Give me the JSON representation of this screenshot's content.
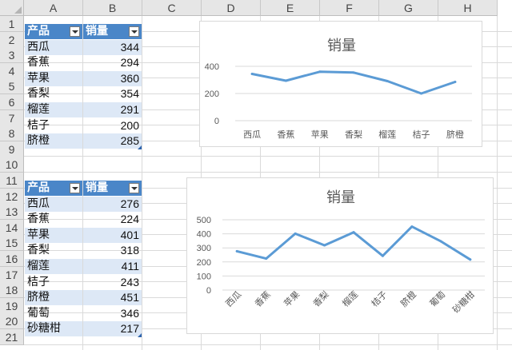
{
  "columns": [
    "A",
    "B",
    "C",
    "D",
    "E",
    "F",
    "G",
    "H"
  ],
  "rows": [
    "1",
    "2",
    "3",
    "4",
    "5",
    "6",
    "7",
    "8",
    "9",
    "10",
    "11",
    "12",
    "13",
    "14",
    "15",
    "16",
    "17",
    "18",
    "19",
    "20",
    "21"
  ],
  "table1": {
    "header": {
      "product": "产品",
      "sales": "销量"
    },
    "rows": [
      {
        "product": "西瓜",
        "sales": "344"
      },
      {
        "product": "香蕉",
        "sales": "294"
      },
      {
        "product": "苹果",
        "sales": "360"
      },
      {
        "product": "香梨",
        "sales": "354"
      },
      {
        "product": "榴莲",
        "sales": "291"
      },
      {
        "product": "桔子",
        "sales": "200"
      },
      {
        "product": "脐橙",
        "sales": "285"
      }
    ]
  },
  "table2": {
    "header": {
      "product": "产品",
      "sales": "销量"
    },
    "rows": [
      {
        "product": "西瓜",
        "sales": "276"
      },
      {
        "product": "香蕉",
        "sales": "224"
      },
      {
        "product": "苹果",
        "sales": "401"
      },
      {
        "product": "香梨",
        "sales": "318"
      },
      {
        "product": "榴莲",
        "sales": "411"
      },
      {
        "product": "桔子",
        "sales": "243"
      },
      {
        "product": "脐橙",
        "sales": "451"
      },
      {
        "product": "葡萄",
        "sales": "346"
      },
      {
        "product": "砂糖柑",
        "sales": "217"
      }
    ]
  },
  "colors": {
    "line": "#5b9bd5",
    "header_fill": "#4a86c8",
    "band_fill": "#dde8f6",
    "gridline": "#d9d9d9"
  },
  "chart_data": [
    {
      "type": "line",
      "title": "销量",
      "categories": [
        "西瓜",
        "香蕉",
        "苹果",
        "香梨",
        "榴莲",
        "桔子",
        "脐橙"
      ],
      "values": [
        344,
        294,
        360,
        354,
        291,
        200,
        285
      ],
      "ylim": [
        0,
        400
      ],
      "yticks": [
        "0",
        "200",
        "400"
      ],
      "grid": true,
      "legend": "none"
    },
    {
      "type": "line",
      "title": "销量",
      "categories": [
        "西瓜",
        "香蕉",
        "苹果",
        "香梨",
        "榴莲",
        "桔子",
        "脐橙",
        "葡萄",
        "砂糖柑"
      ],
      "values": [
        276,
        224,
        401,
        318,
        411,
        243,
        451,
        346,
        217
      ],
      "ylim": [
        0,
        500
      ],
      "yticks": [
        "0",
        "100",
        "200",
        "300",
        "400",
        "500"
      ],
      "grid": true,
      "legend": "none"
    }
  ]
}
